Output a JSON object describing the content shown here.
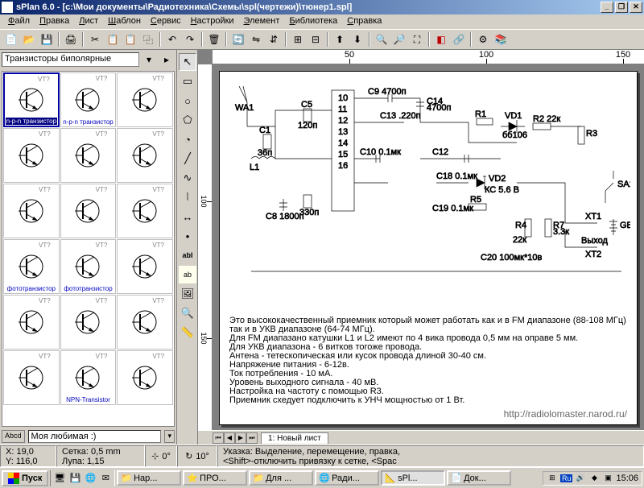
{
  "title": "sPlan 6.0 - [с:\\Мои документы\\Радиотехника\\Схемы\\spl(чертежи)\\тюнер1.spl]",
  "menus": [
    "Файл",
    "Правка",
    "Лист",
    "Шаблон",
    "Сервис",
    "Настройки",
    "Элемент",
    "Библиотека",
    "Справка"
  ],
  "palette": {
    "category": "Транзисторы биполярные",
    "items": [
      {
        "label": "n-p-n транзистор",
        "ref": "VT?",
        "sel": true
      },
      {
        "label": "n-p-n транзистор",
        "ref": "VT?"
      },
      {
        "label": "",
        "ref": "VT?"
      },
      {
        "label": "",
        "ref": "VT?"
      },
      {
        "label": "",
        "ref": "VT?"
      },
      {
        "label": "",
        "ref": "VT?"
      },
      {
        "label": "",
        "ref": "VT?"
      },
      {
        "label": "",
        "ref": "VT?"
      },
      {
        "label": "",
        "ref": "VT?"
      },
      {
        "label": "фототранзистор",
        "ref": "VT?"
      },
      {
        "label": "фототранзистор",
        "ref": "VT?"
      },
      {
        "label": "",
        "ref": "VT?"
      },
      {
        "label": "",
        "ref": "VT?"
      },
      {
        "label": "",
        "ref": "VT?"
      },
      {
        "label": "",
        "ref": "VT?"
      },
      {
        "label": "",
        "ref": "VT?"
      },
      {
        "label": "NPN-Transistor",
        "ref": "VT?"
      },
      {
        "label": "",
        "ref": "VT?"
      }
    ],
    "footer_btn": "Abcd",
    "footer_text": "Моя любимая :)"
  },
  "ruler": {
    "h": [
      "50",
      "100",
      "150"
    ],
    "v": [
      "100",
      "150"
    ]
  },
  "description": [
    "Это высококачественный приемник который может работать как и в FM диапазоне (88-108 МГц),",
    "так и в УКВ диапазоне (64-74 МГц).",
    "Для FM диапазано катушки L1 и  L2 имеют по 4 вика провода 0,5 мм на оправе 5 мм.",
    "Для УКВ диапазона - 6 витков тогоже провода.",
    "Антена - тетескопическая или кусок провода длиной 30-40 см.",
    "Напряжение питания - 6-12в.",
    "Ток потребления - 10 мА.",
    "Уровень выходного сигнала - 40 мВ.",
    "Настройка на частоту с помощью R3.",
    "Приемник схедует подключить к УНЧ мощностью от 1 Вт."
  ],
  "watermark": "http://radiolomaster.narod.ru/",
  "tab": "1: Новый лист",
  "status": {
    "x": "X: 19,0",
    "y": "Y: 116,0",
    "grid": "Сетка:  0,5 mm",
    "zoom": "Лупа:   1,15",
    "angle_a": "0°",
    "angle_b": "10°",
    "hint1": "Указка: Выделение, перемещение, правка, ",
    "hint2": "<Shift>-отключить привязку к сетке, <Spac"
  },
  "taskbar": {
    "start": "Пуск",
    "tasks": [
      {
        "icon": "📁",
        "label": "Нар..."
      },
      {
        "icon": "⭐",
        "label": "ПРО..."
      },
      {
        "icon": "📁",
        "label": "Для ..."
      },
      {
        "icon": "🌐",
        "label": "Ради..."
      },
      {
        "icon": "📐",
        "label": "sPl...",
        "active": true
      },
      {
        "icon": "📄",
        "label": "Док..."
      }
    ],
    "tray_lang": "Ru",
    "clock": "15:06"
  }
}
